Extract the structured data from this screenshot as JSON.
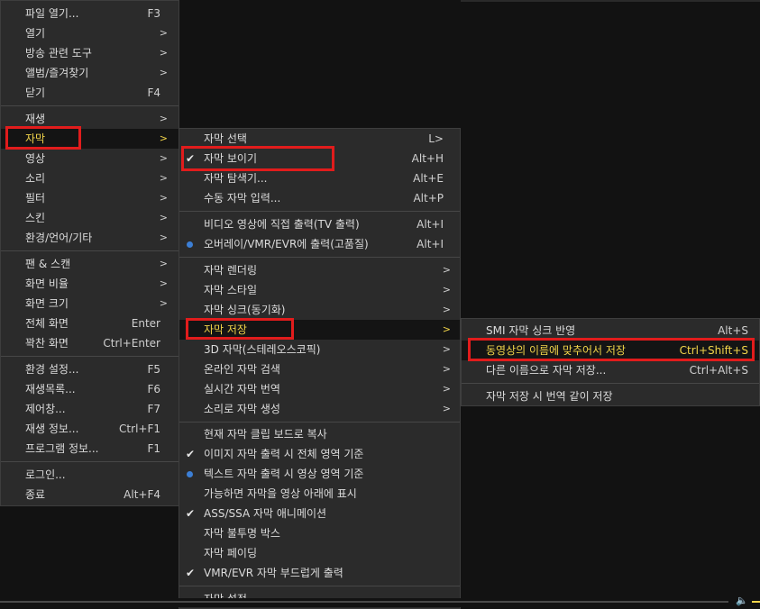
{
  "menu1": {
    "items": [
      {
        "label": "파일 열기...",
        "shortcut": "F3"
      },
      {
        "label": "열기",
        "shortcut": ">"
      },
      {
        "label": "방송 관련 도구",
        "shortcut": ">"
      },
      {
        "label": "앨범/즐겨찾기",
        "shortcut": ">"
      },
      {
        "label": "닫기",
        "shortcut": "F4"
      },
      {
        "label": "재생",
        "shortcut": ">"
      },
      {
        "label": "자막",
        "shortcut": ">"
      },
      {
        "label": "영상",
        "shortcut": ">"
      },
      {
        "label": "소리",
        "shortcut": ">"
      },
      {
        "label": "필터",
        "shortcut": ">"
      },
      {
        "label": "스킨",
        "shortcut": ">"
      },
      {
        "label": "환경/언어/기타",
        "shortcut": ">"
      },
      {
        "label": "팬 & 스캔",
        "shortcut": ">"
      },
      {
        "label": "화면 비율",
        "shortcut": ">"
      },
      {
        "label": "화면 크기",
        "shortcut": ">"
      },
      {
        "label": "전체 화면",
        "shortcut": "Enter"
      },
      {
        "label": "꽉찬 화면",
        "shortcut": "Ctrl+Enter"
      },
      {
        "label": "환경 설정...",
        "shortcut": "F5"
      },
      {
        "label": "재생목록...",
        "shortcut": "F6"
      },
      {
        "label": "제어창...",
        "shortcut": "F7"
      },
      {
        "label": "재생 정보...",
        "shortcut": "Ctrl+F1"
      },
      {
        "label": "프로그램 정보...",
        "shortcut": "F1"
      },
      {
        "label": "로그인...",
        "shortcut": ""
      },
      {
        "label": "종료",
        "shortcut": "Alt+F4"
      }
    ]
  },
  "menu2": {
    "items": [
      {
        "label": "자막 선택",
        "shortcut": "L>"
      },
      {
        "label": "자막 보이기",
        "shortcut": "Alt+H"
      },
      {
        "label": "자막 탐색기...",
        "shortcut": "Alt+E"
      },
      {
        "label": "수동 자막 입력...",
        "shortcut": "Alt+P"
      },
      {
        "label": "비디오 영상에 직접 출력(TV 출력)",
        "shortcut": "Alt+I"
      },
      {
        "label": "오버레이/VMR/EVR에 출력(고품질)",
        "shortcut": "Alt+I"
      },
      {
        "label": "자막 렌더링",
        "shortcut": ">"
      },
      {
        "label": "자막 스타일",
        "shortcut": ">"
      },
      {
        "label": "자막 싱크(동기화)",
        "shortcut": ">"
      },
      {
        "label": "자막 저장",
        "shortcut": ">"
      },
      {
        "label": "3D 자막(스테레오스코픽)",
        "shortcut": ">"
      },
      {
        "label": "온라인 자막 검색",
        "shortcut": ">"
      },
      {
        "label": "실시간 자막 번역",
        "shortcut": ">"
      },
      {
        "label": "소리로 자막 생성",
        "shortcut": ">"
      },
      {
        "label": "현재 자막 클립 보드로 복사",
        "shortcut": ""
      },
      {
        "label": "이미지 자막 출력 시 전체 영역 기준",
        "shortcut": ""
      },
      {
        "label": "텍스트 자막 출력 시 영상 영역 기준",
        "shortcut": ""
      },
      {
        "label": "가능하면 자막을 영상 아래에 표시",
        "shortcut": ""
      },
      {
        "label": "ASS/SSA 자막 애니메이션",
        "shortcut": ""
      },
      {
        "label": "자막 불투명 박스",
        "shortcut": ""
      },
      {
        "label": "자막 페이딩",
        "shortcut": ""
      },
      {
        "label": "VMR/EVR 자막 부드럽게 출력",
        "shortcut": ""
      },
      {
        "label": "자막 설정...",
        "shortcut": ""
      }
    ]
  },
  "menu3": {
    "items": [
      {
        "label": "SMI 자막 싱크 반영",
        "shortcut": "Alt+S"
      },
      {
        "label": "동영상의 이름에 맞추어서 저장",
        "shortcut": "Ctrl+Shift+S"
      },
      {
        "label": "다른 이름으로 자막 저장...",
        "shortcut": "Ctrl+Alt+S"
      },
      {
        "label": "자막 저장 시 번역 같이 저장",
        "shortcut": ""
      }
    ]
  },
  "icons": {
    "check": "check-icon",
    "radio": "radio-dot-icon",
    "volume": "volume-icon"
  },
  "colors": {
    "highlight_text": "#f2d54a",
    "annotation_box": "#e11c1c",
    "radio_dot": "#3c7fd6"
  }
}
